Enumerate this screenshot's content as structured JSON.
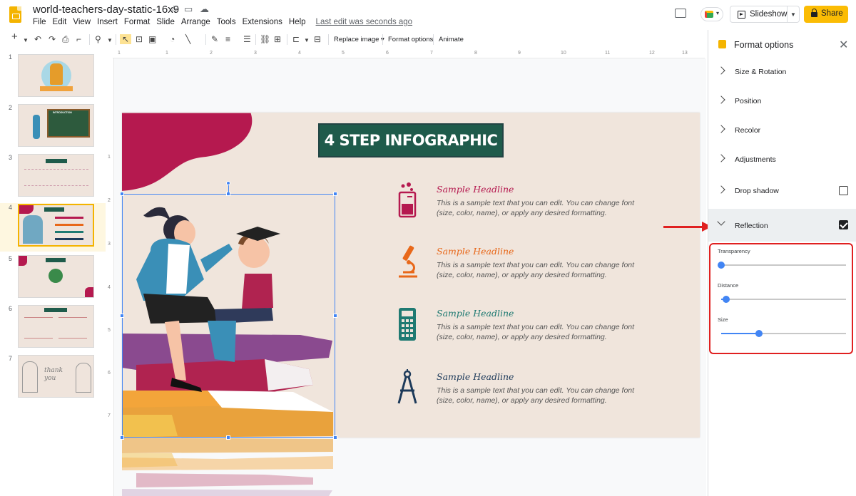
{
  "app": {
    "doc_title": "world-teachers-day-static-16x9",
    "menu": [
      "File",
      "Edit",
      "View",
      "Insert",
      "Format",
      "Slide",
      "Arrange",
      "Tools",
      "Extensions",
      "Help"
    ],
    "last_edit": "Last edit was seconds ago",
    "slideshow_label": "Slideshow",
    "share_label": "Share"
  },
  "toolbar": {
    "replace_image": "Replace image ▾",
    "format_options": "Format options",
    "animate": "Animate"
  },
  "filmstrip": {
    "slides": [
      "1",
      "2",
      "3",
      "4",
      "5",
      "6",
      "7"
    ],
    "selected": "4",
    "slide2_label": "INTRODUCTION",
    "slide7_text": "thank you"
  },
  "ruler": {
    "top": [
      "1",
      "1",
      "2",
      "3",
      "4",
      "5",
      "6",
      "7",
      "8",
      "9",
      "10",
      "11",
      "12",
      "13"
    ],
    "left": [
      "1",
      "2",
      "3",
      "4",
      "5",
      "6",
      "7"
    ]
  },
  "slide": {
    "title": "4 STEP INFOGRAPHIC",
    "steps": [
      {
        "headline": "Sample Headline",
        "color": "#b5194f",
        "icon": "beaker-icon",
        "body": "This is a sample text that you can edit. You can change font (size, color, name), or apply any desired formatting."
      },
      {
        "headline": "Sample Headline",
        "color": "#e8681a",
        "icon": "microscope-icon",
        "body": "This is a sample text that you can edit. You can change font (size, color, name), or apply any desired formatting."
      },
      {
        "headline": "Sample Headline",
        "color": "#1f7a72",
        "icon": "calculator-icon",
        "body": "This is a sample text that you can edit. You can change font (size, color, name), or apply any desired formatting."
      },
      {
        "headline": "Sample Headline",
        "color": "#1d3a5a",
        "icon": "compass-icon",
        "body": "This is a sample text that you can edit. You can change font (size, color, name), or apply any desired formatting."
      }
    ]
  },
  "panel": {
    "title": "Format options",
    "sections": [
      {
        "label": "Size & Rotation"
      },
      {
        "label": "Position"
      },
      {
        "label": "Recolor"
      },
      {
        "label": "Adjustments"
      },
      {
        "label": "Drop shadow",
        "checked": false
      },
      {
        "label": "Reflection",
        "checked": true
      }
    ],
    "sliders": [
      {
        "label": "Transparency",
        "value": 0
      },
      {
        "label": "Distance",
        "value": 0.04
      },
      {
        "label": "Size",
        "value": 0.3
      }
    ]
  },
  "colors": {
    "accent": "#fbbc04",
    "selection": "#4285f4",
    "annotation": "#e02020"
  }
}
